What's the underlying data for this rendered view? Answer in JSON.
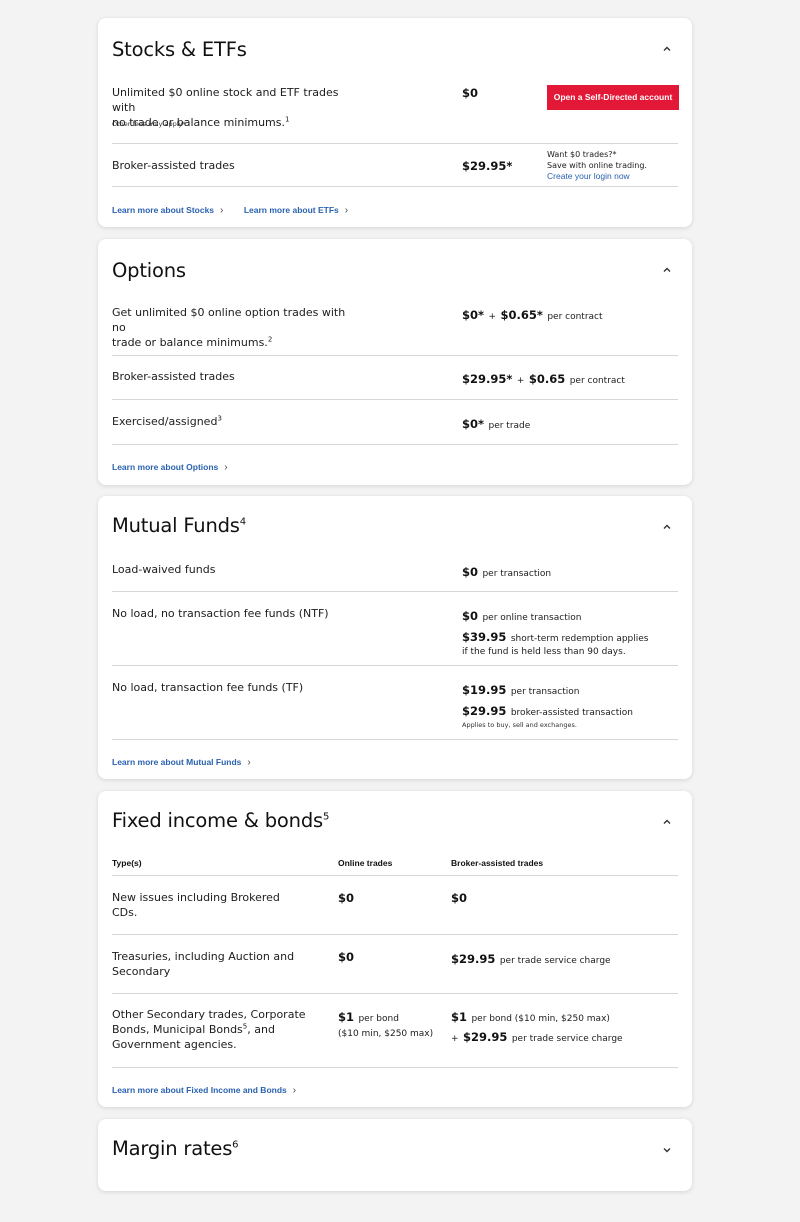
{
  "stocks": {
    "title": "Stocks & ETFs",
    "row1_desc_l1": "Unlimited $0 online stock and ETF trades with",
    "row1_desc_l2": "no trade or balance minimums.",
    "row1_sup": "1",
    "row1_note": "Other fees may apply*",
    "row1_price": "$0",
    "open_button": "Open a Self-Directed account",
    "row2_desc": "Broker-assisted trades",
    "row2_price": "$29.95*",
    "promo_l1": "Want $0 trades?*",
    "promo_l2": "Save with online trading.",
    "promo_link": "Create your login now",
    "link1": "Learn more about Stocks",
    "link2": "Learn more about ETFs"
  },
  "options": {
    "title": "Options",
    "row1_desc_l1": "Get unlimited $0 online option trades with no",
    "row1_desc_l2": "trade or balance minimums.",
    "row1_sup": "2",
    "row1_price_a": "$0*",
    "row1_plus": "+",
    "row1_price_b": "$0.65*",
    "row1_unit": "per contract",
    "row2_desc": "Broker-assisted trades",
    "row2_price_a": "$29.95*",
    "row2_plus": "+",
    "row2_price_b": "$0.65",
    "row2_unit": "per contract",
    "row3_desc": "Exercised/assigned",
    "row3_sup": "3",
    "row3_price": "$0*",
    "row3_unit": "per trade",
    "link": "Learn more about Options"
  },
  "mutual": {
    "title": "Mutual Funds",
    "title_sup": "4",
    "row1_desc": "Load-waived funds",
    "row1_price": "$0",
    "row1_unit": "per transaction",
    "row2_desc": "No load, no transaction fee funds (NTF)",
    "row2_price": "$0",
    "row2_unit": "per online transaction",
    "row2_price2": "$39.95",
    "row2_unit2": "short-term redemption applies",
    "row2_note": "if the fund is held less than 90 days.",
    "row3_desc": "No load, transaction fee funds (TF)",
    "row3_price": "$19.95",
    "row3_unit": "per transaction",
    "row3_price2": "$29.95",
    "row3_unit2": "broker-assisted transaction",
    "row3_note": "Applies to buy, sell and exchanges.",
    "link": "Learn more about Mutual Funds"
  },
  "fixed": {
    "title": "Fixed income & bonds",
    "title_sup": "5",
    "col_type": "Type(s)",
    "col_online": "Online trades",
    "col_broker": "Broker-assisted trades",
    "row1_desc_l1": "New issues including Brokered",
    "row1_desc_l2": "CDs.",
    "row1_online": "$0",
    "row1_broker": "$0",
    "row2_desc_l1": "Treasuries, including Auction and",
    "row2_desc_l2": "Secondary",
    "row2_online": "$0",
    "row2_broker": "$29.95",
    "row2_broker_unit": "per trade service charge",
    "row3_desc_l1": "Other Secondary trades, Corporate",
    "row3_desc_l2a": "Bonds, Municipal Bonds",
    "row3_sup": "5",
    "row3_desc_l2b": ", and",
    "row3_desc_l3": "Government agencies.",
    "row3_online": "$1",
    "row3_online_unit": "per bond",
    "row3_online_note": "($10 min, $250 max)",
    "row3_broker": "$1",
    "row3_broker_unit": "per bond ($10 min, $250 max)",
    "row3_broker_plus": "+",
    "row3_broker2": "$29.95",
    "row3_broker2_unit": "per trade service charge",
    "link": "Learn more about Fixed Income and Bonds"
  },
  "margin": {
    "title": "Margin rates",
    "title_sup": "6"
  },
  "colors": {
    "accent_red": "#e31837",
    "link_blue": "#2a62b0",
    "background": "#f3f3f3"
  }
}
